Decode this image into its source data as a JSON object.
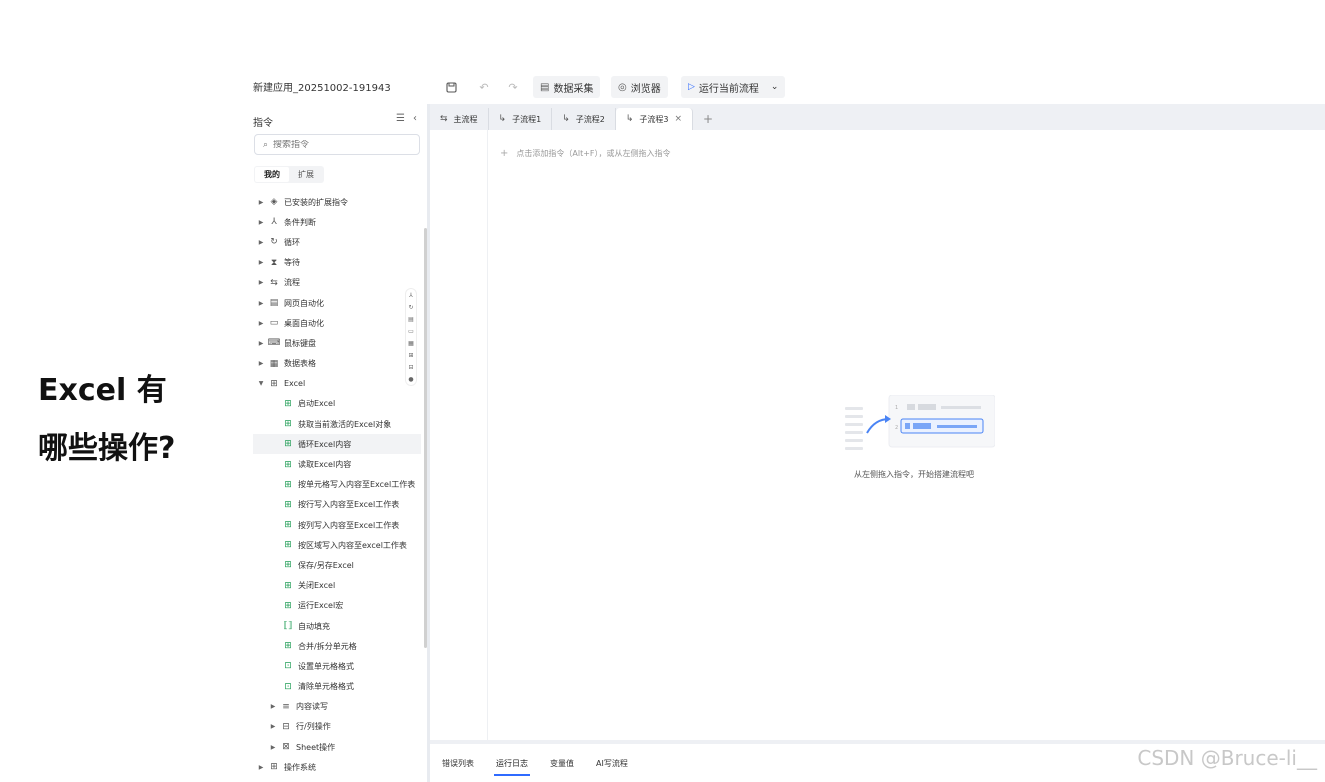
{
  "caption": {
    "line1": "Excel 有",
    "line2": "哪些操作?"
  },
  "toolbar": {
    "app_title": "新建应用_20251002-191943",
    "data_collect": "数据采集",
    "browser": "浏览器",
    "run_current": "运行当前流程"
  },
  "sidebar": {
    "header": "指令",
    "search_placeholder": "搜索指令",
    "seg_mine": "我的",
    "seg_ext": "扩展",
    "items": [
      {
        "label": "已安装的扩展指令",
        "icon": "package-icon",
        "glyph": "◈",
        "level": 1,
        "expanded": false
      },
      {
        "label": "条件判断",
        "icon": "branch-icon",
        "glyph": "⅄",
        "level": 1,
        "expanded": false
      },
      {
        "label": "循环",
        "icon": "loop-icon",
        "glyph": "↻",
        "level": 1,
        "expanded": false
      },
      {
        "label": "等待",
        "icon": "hourglass-icon",
        "glyph": "⧗",
        "level": 1,
        "expanded": false
      },
      {
        "label": "流程",
        "icon": "flow-icon",
        "glyph": "⇆",
        "level": 1,
        "expanded": false
      },
      {
        "label": "网页自动化",
        "icon": "webpage-icon",
        "glyph": "▤",
        "level": 1,
        "expanded": false
      },
      {
        "label": "桌面自动化",
        "icon": "desktop-icon",
        "glyph": "▭",
        "level": 1,
        "expanded": false
      },
      {
        "label": "鼠标键盘",
        "icon": "keyboard-icon",
        "glyph": "⌨",
        "level": 1,
        "expanded": false
      },
      {
        "label": "数据表格",
        "icon": "datatable-icon",
        "glyph": "▦",
        "level": 1,
        "expanded": false
      },
      {
        "label": "Excel",
        "icon": "excel-icon",
        "glyph": "⊞",
        "level": 1,
        "expanded": true
      },
      {
        "label": "启动Excel",
        "icon": "excel-start-icon",
        "glyph": "⊞",
        "level": 2
      },
      {
        "label": "获取当前激活的Excel对象",
        "icon": "excel-active-icon",
        "glyph": "⊞",
        "level": 2
      },
      {
        "label": "循环Excel内容",
        "icon": "excel-loop-icon",
        "glyph": "⊞",
        "level": 2,
        "highlight": true
      },
      {
        "label": "读取Excel内容",
        "icon": "excel-read-icon",
        "glyph": "⊞",
        "level": 2
      },
      {
        "label": "按单元格写入内容至Excel工作表",
        "icon": "excel-write-cell-icon",
        "glyph": "⊞",
        "level": 2
      },
      {
        "label": "按行写入内容至Excel工作表",
        "icon": "excel-write-row-icon",
        "glyph": "⊞",
        "level": 2
      },
      {
        "label": "按列写入内容至Excel工作表",
        "icon": "excel-write-col-icon",
        "glyph": "⊞",
        "level": 2
      },
      {
        "label": "按区域写入内容至excel工作表",
        "icon": "excel-write-range-icon",
        "glyph": "⊞",
        "level": 2
      },
      {
        "label": "保存/另存Excel",
        "icon": "excel-save-icon",
        "glyph": "⊞",
        "level": 2
      },
      {
        "label": "关闭Excel",
        "icon": "excel-close-icon",
        "glyph": "⊞",
        "level": 2
      },
      {
        "label": "运行Excel宏",
        "icon": "excel-macro-icon",
        "glyph": "⊞",
        "level": 2
      },
      {
        "label": "自动填充",
        "icon": "autofill-icon",
        "glyph": "⟦⟧",
        "level": 2
      },
      {
        "label": "合并/拆分单元格",
        "icon": "merge-cells-icon",
        "glyph": "⊞",
        "level": 2
      },
      {
        "label": "设置单元格格式",
        "icon": "cell-format-icon",
        "glyph": "⊡",
        "level": 2
      },
      {
        "label": "清除单元格格式",
        "icon": "clear-format-icon",
        "glyph": "⊡",
        "level": 2
      },
      {
        "label": "内容读写",
        "icon": "read-write-icon",
        "glyph": "≡",
        "level": 3,
        "expanded": false
      },
      {
        "label": "行/列操作",
        "icon": "row-col-icon",
        "glyph": "⊟",
        "level": 3,
        "expanded": false
      },
      {
        "label": "Sheet操作",
        "icon": "sheet-icon",
        "glyph": "⊠",
        "level": 3,
        "expanded": false
      },
      {
        "label": "操作系统",
        "icon": "os-icon",
        "glyph": "⊞",
        "level": 1,
        "expanded": false
      }
    ]
  },
  "tabs": [
    {
      "label": "主流程",
      "active": false,
      "closable": false
    },
    {
      "label": "子流程1",
      "active": false,
      "closable": false
    },
    {
      "label": "子流程2",
      "active": false,
      "closable": false
    },
    {
      "label": "子流程3",
      "active": true,
      "closable": true
    }
  ],
  "canvas": {
    "add_hint": "点击添加指令（Alt+F），或从左侧拖入指令",
    "empty_text": "从左侧拖入指令，开始搭建流程吧"
  },
  "bottom_tabs": [
    {
      "label": "错误列表",
      "active": false
    },
    {
      "label": "运行日志",
      "active": true
    },
    {
      "label": "变量值",
      "active": false
    },
    {
      "label": "AI写流程",
      "active": false
    }
  ],
  "watermark": "CSDN @Bruce-li__",
  "colors": {
    "accent": "#2f6bff",
    "excel_green": "#1f9d55"
  }
}
